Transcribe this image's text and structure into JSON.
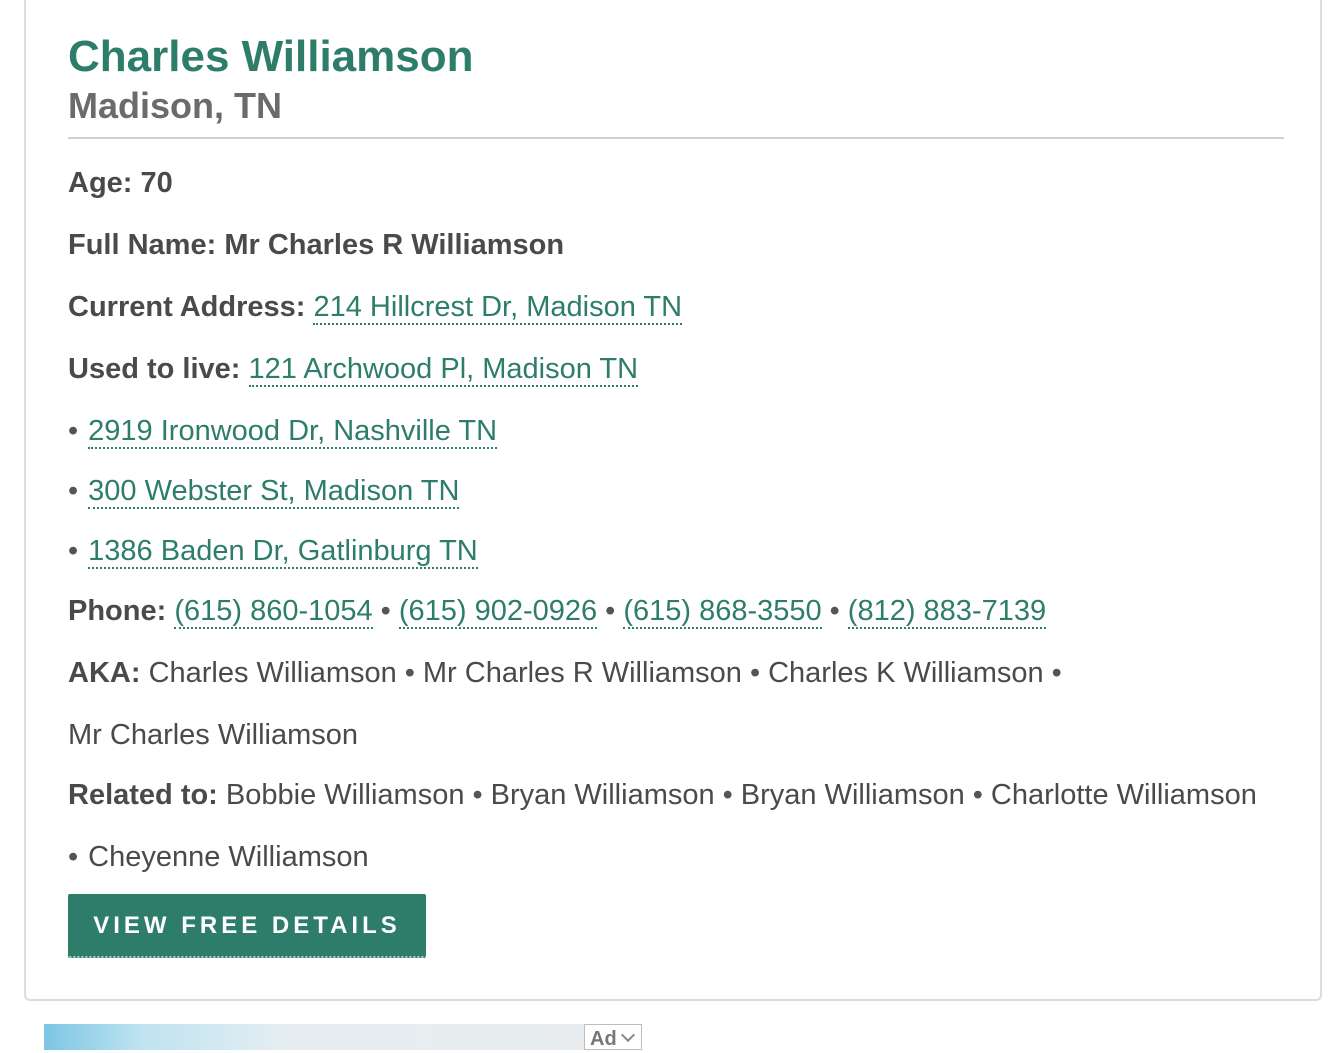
{
  "person": {
    "name": "Charles Williamson",
    "location": "Madison, TN"
  },
  "details": {
    "age_label": "Age: 70",
    "full_name_label": "Full Name:",
    "full_name": "Mr Charles R Williamson",
    "current_address_label": "Current Address:",
    "current_address": "214 Hillcrest Dr, Madison TN",
    "used_to_live_label": "Used to live:",
    "previous_addresses": [
      "121 Archwood Pl, Madison TN",
      "2919 Ironwood Dr, Nashville TN",
      "300 Webster St, Madison TN",
      "1386 Baden Dr, Gatlinburg TN"
    ],
    "phone_label": "Phone:",
    "phones": [
      "(615) 860-1054",
      "(615) 902-0926",
      "(615) 868-3550",
      "(812) 883-7139"
    ],
    "aka_label": "AKA:",
    "aka": [
      "Charles Williamson",
      "Mr Charles R Williamson",
      "Charles K Williamson",
      "Mr Charles Williamson"
    ],
    "related_label": "Related to:",
    "related": [
      "Bobbie Williamson",
      "Bryan Williamson",
      "Bryan Williamson",
      "Charlotte Williamson",
      "Cheyenne Williamson"
    ],
    "separator": "•"
  },
  "cta": {
    "label": "VIEW FREE DETAILS"
  },
  "ad": {
    "badge_label": "Ad"
  },
  "colors": {
    "accent": "#2e7d6b",
    "location_gray": "#6b6b6b",
    "text": "#4a4a4a"
  }
}
